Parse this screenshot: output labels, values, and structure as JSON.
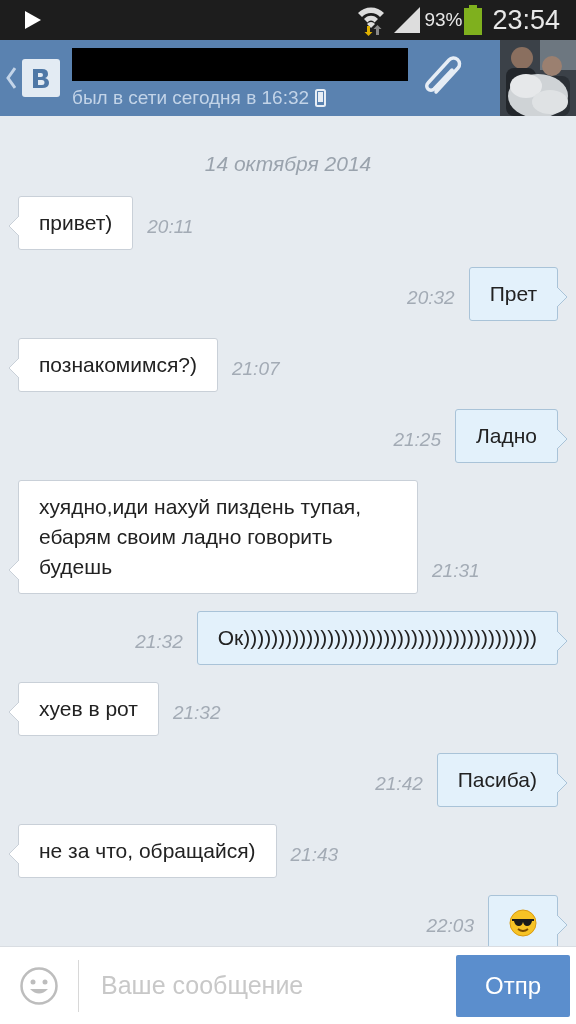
{
  "status_bar": {
    "battery": "93%",
    "time": "23:54"
  },
  "header": {
    "last_seen": "был в сети сегодня в 16:32"
  },
  "chat": {
    "date": "14 октября 2014",
    "messages": [
      {
        "kind": "text",
        "outgoing": false,
        "text": "привет)",
        "time": "20:11"
      },
      {
        "kind": "text",
        "outgoing": true,
        "text": "Прет",
        "time": "20:32"
      },
      {
        "kind": "text",
        "outgoing": false,
        "text": "познакомимся?)",
        "time": "21:07"
      },
      {
        "kind": "text",
        "outgoing": true,
        "text": "Ладно",
        "time": "21:25"
      },
      {
        "kind": "text",
        "outgoing": false,
        "text": "хуядно,иди нахуй пиздень тупая, ебарям своим ладно говорить будешь",
        "time": "21:31"
      },
      {
        "kind": "text",
        "outgoing": true,
        "text": "Ок))))))))))))))))))))))))))))))))))))))))))",
        "time": "21:32"
      },
      {
        "kind": "text",
        "outgoing": false,
        "text": "хуев в рот",
        "time": "21:32"
      },
      {
        "kind": "text",
        "outgoing": true,
        "text": "Пасиба)",
        "time": "21:42"
      },
      {
        "kind": "text",
        "outgoing": false,
        "text": "не за что, обращайся)",
        "time": "21:43"
      },
      {
        "kind": "emoji",
        "outgoing": true,
        "time": "22:03"
      }
    ]
  },
  "composer": {
    "placeholder": "Ваше сообщение",
    "send_label": "Отпр"
  }
}
